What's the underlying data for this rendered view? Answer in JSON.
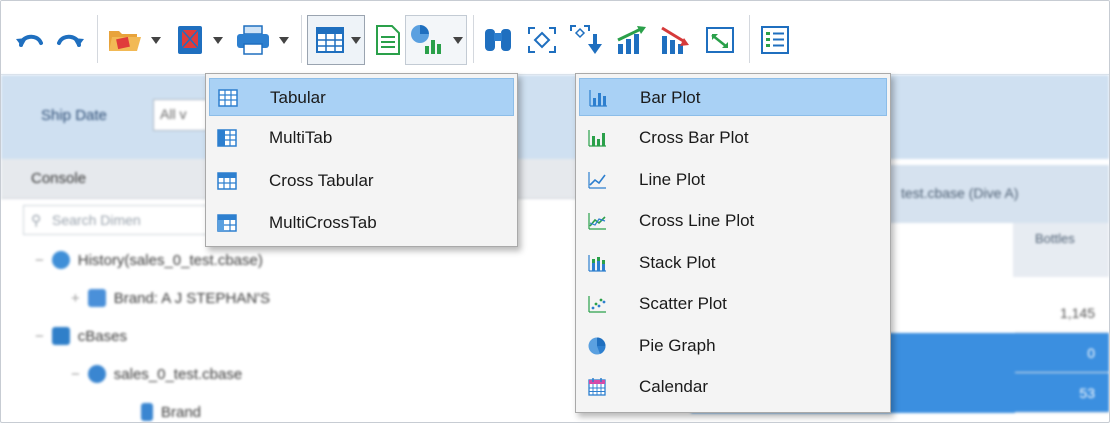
{
  "toolbar": {
    "icons": [
      "undo-icon",
      "redo-icon",
      "open-folder-icon",
      "dropdown-caret",
      "bookmark-icon",
      "dropdown-caret",
      "print-icon",
      "dropdown-caret",
      "tabular-view-icon",
      "dropdown-caret",
      "document-icon",
      "chart-icon",
      "dropdown-caret",
      "binoculars-icon",
      "focus-icon",
      "drill-down-icon",
      "trend-up-icon",
      "trend-down-icon",
      "refresh-icon",
      "list-icon"
    ]
  },
  "filter_bar": {
    "label": "Ship Date",
    "value": "All v"
  },
  "console": {
    "label": "Console",
    "search_placeholder": "Search Dimen"
  },
  "tree": [
    {
      "label": "History(sales_0_test.cbase)",
      "icon_color": "#3f8fd8"
    },
    {
      "label": "Brand: A J STEPHAN'S",
      "icon_color": "#4a90d9"
    },
    {
      "label": "cBases",
      "icon_color": "#2f7fc9"
    },
    {
      "label": "sales_0_test.cbase",
      "icon_color": "#3a86d1"
    },
    {
      "label": "Brand",
      "icon_color": "#3a86d1"
    }
  ],
  "right_pane": {
    "title": "test.cbase (Dive A)",
    "column": "Bottles",
    "values": [
      "1,145",
      "0",
      "53"
    ]
  },
  "tab_menu": {
    "items": [
      {
        "label": "Tabular",
        "icon": "tabular-icon",
        "active": true
      },
      {
        "label": "MultiTab",
        "icon": "multitab-icon",
        "active": false
      },
      {
        "label": "Cross Tabular",
        "icon": "cross-tabular-icon",
        "active": false
      },
      {
        "label": "MultiCrossTab",
        "icon": "multicrosstab-icon",
        "active": false
      }
    ]
  },
  "plot_menu": {
    "items": [
      {
        "label": "Bar Plot",
        "icon": "bar-plot-icon",
        "active": true
      },
      {
        "label": "Cross Bar Plot",
        "icon": "cross-bar-plot-icon",
        "active": false
      },
      {
        "label": "Line Plot",
        "icon": "line-plot-icon",
        "active": false
      },
      {
        "label": "Cross Line Plot",
        "icon": "cross-line-plot-icon",
        "active": false
      },
      {
        "label": "Stack Plot",
        "icon": "stack-plot-icon",
        "active": false
      },
      {
        "label": "Scatter Plot",
        "icon": "scatter-plot-icon",
        "active": false
      },
      {
        "label": "Pie Graph",
        "icon": "pie-graph-icon",
        "active": false
      },
      {
        "label": "Calendar",
        "icon": "calendar-icon",
        "active": false
      }
    ]
  },
  "colors": {
    "accent": "#3b8fe0",
    "menu_highlight": "#a9d1f5",
    "toolbar_blue": "#1f6fbf",
    "chart_green": "#2aa04a",
    "chart_red": "#d63a3a"
  }
}
